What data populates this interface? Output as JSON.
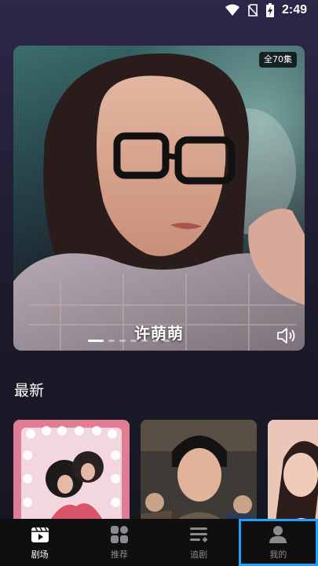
{
  "status_bar": {
    "time": "2:49"
  },
  "banner": {
    "episode_badge": "全70集",
    "title": "许萌萌",
    "slide_count": 7,
    "active_slide": 0
  },
  "sections": {
    "latest_title": "最新"
  },
  "tabs": [
    {
      "label": "剧场",
      "icon": "theater-icon",
      "active": true
    },
    {
      "label": "推荐",
      "icon": "grid-icon",
      "active": false
    },
    {
      "label": "追剧",
      "icon": "playlist-icon",
      "active": false
    },
    {
      "label": "我的",
      "icon": "profile-icon",
      "active": false
    }
  ],
  "colors": {
    "highlight": "#1fa2ff",
    "tab_active": "#ffffff",
    "tab_inactive": "#8b8b8f"
  }
}
